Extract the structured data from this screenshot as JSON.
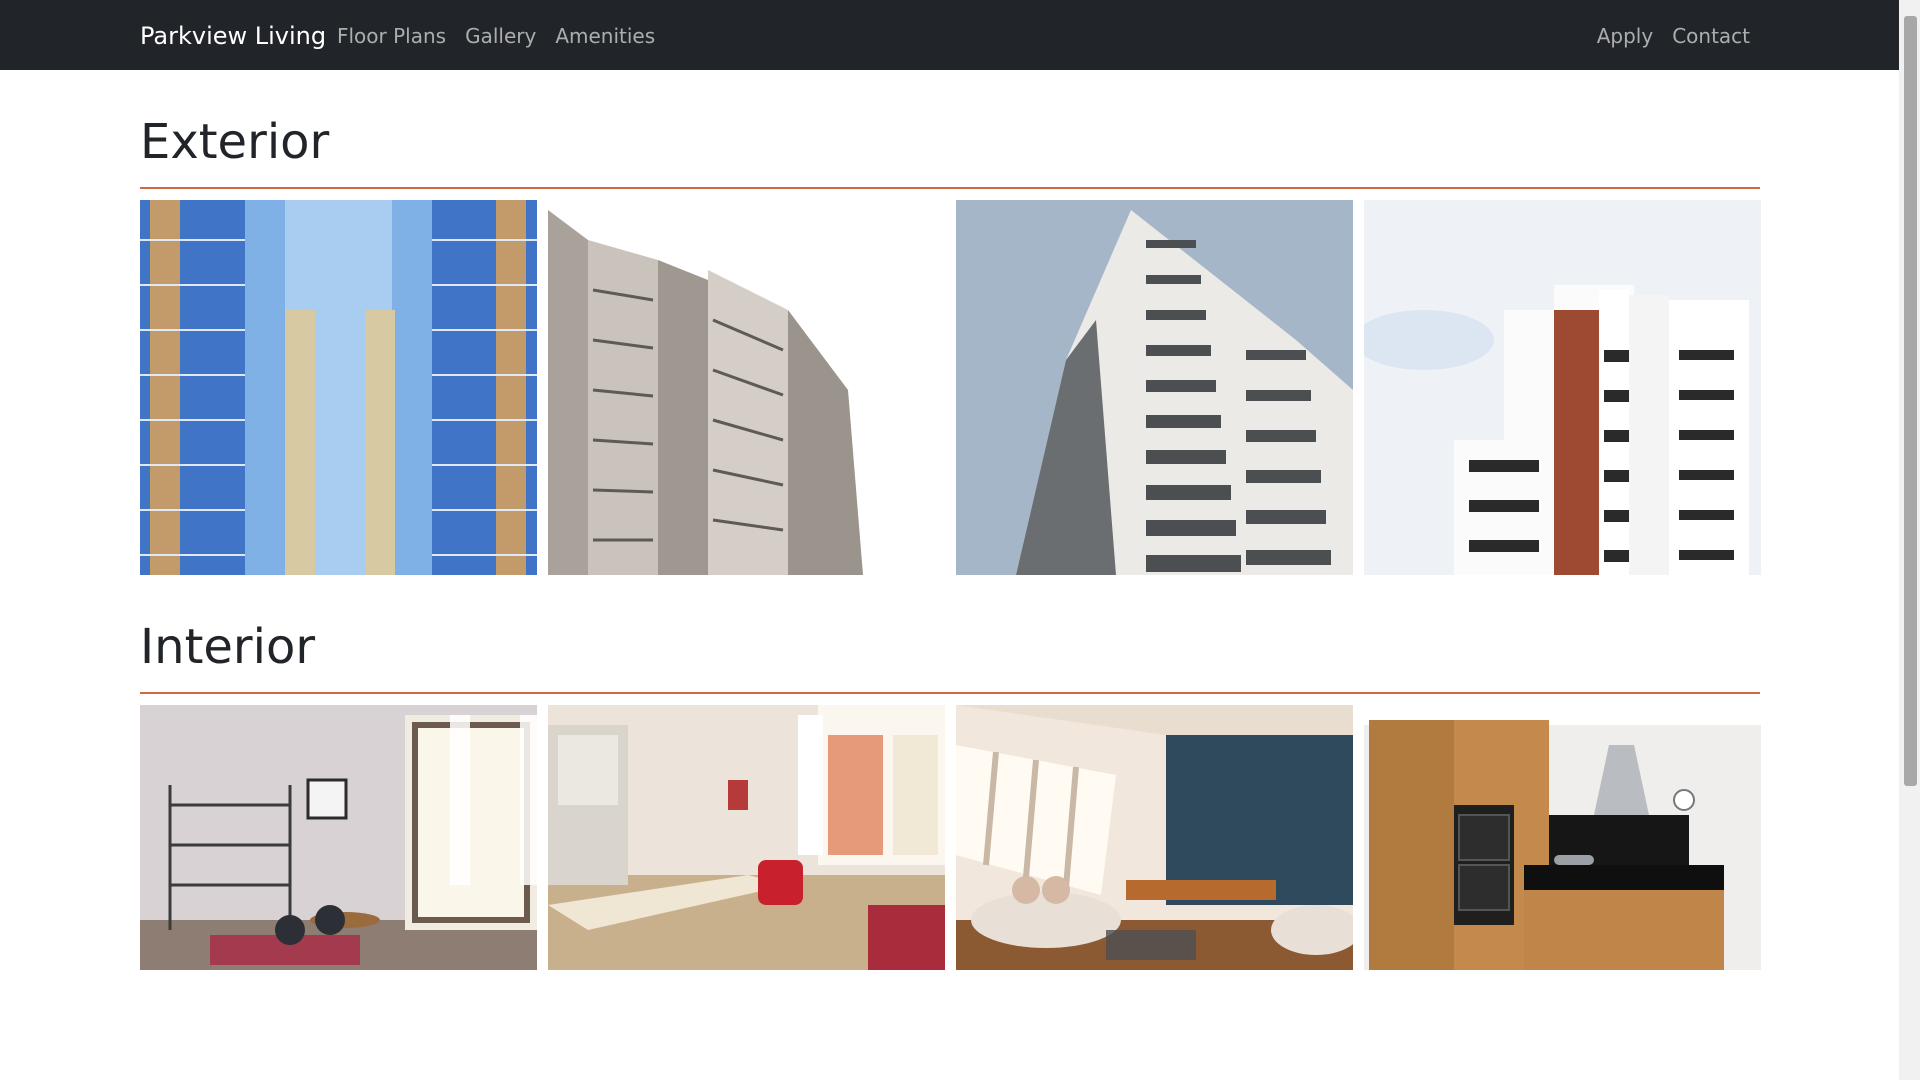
{
  "navbar": {
    "brand": "Parkview Living",
    "left_links": [
      "Floor Plans",
      "Gallery",
      "Amenities"
    ],
    "right_links": [
      "Apply",
      "Contact"
    ]
  },
  "sections": [
    {
      "title": "Exterior",
      "photos": [
        {
          "icon": "glass-tower-photo"
        },
        {
          "icon": "concrete-tower-photo"
        },
        {
          "icon": "highrise-balconies-photo"
        },
        {
          "icon": "white-red-tower-photo"
        }
      ]
    },
    {
      "title": "Interior",
      "photos": [
        {
          "icon": "dining-room-harp-photo"
        },
        {
          "icon": "kitchen-dining-photo"
        },
        {
          "icon": "attic-living-room-photo"
        },
        {
          "icon": "wood-kitchen-photo"
        }
      ]
    }
  ],
  "colors": {
    "navbar_bg": "#212529",
    "divider": "#d2693c",
    "link": "#9ea0a2"
  }
}
